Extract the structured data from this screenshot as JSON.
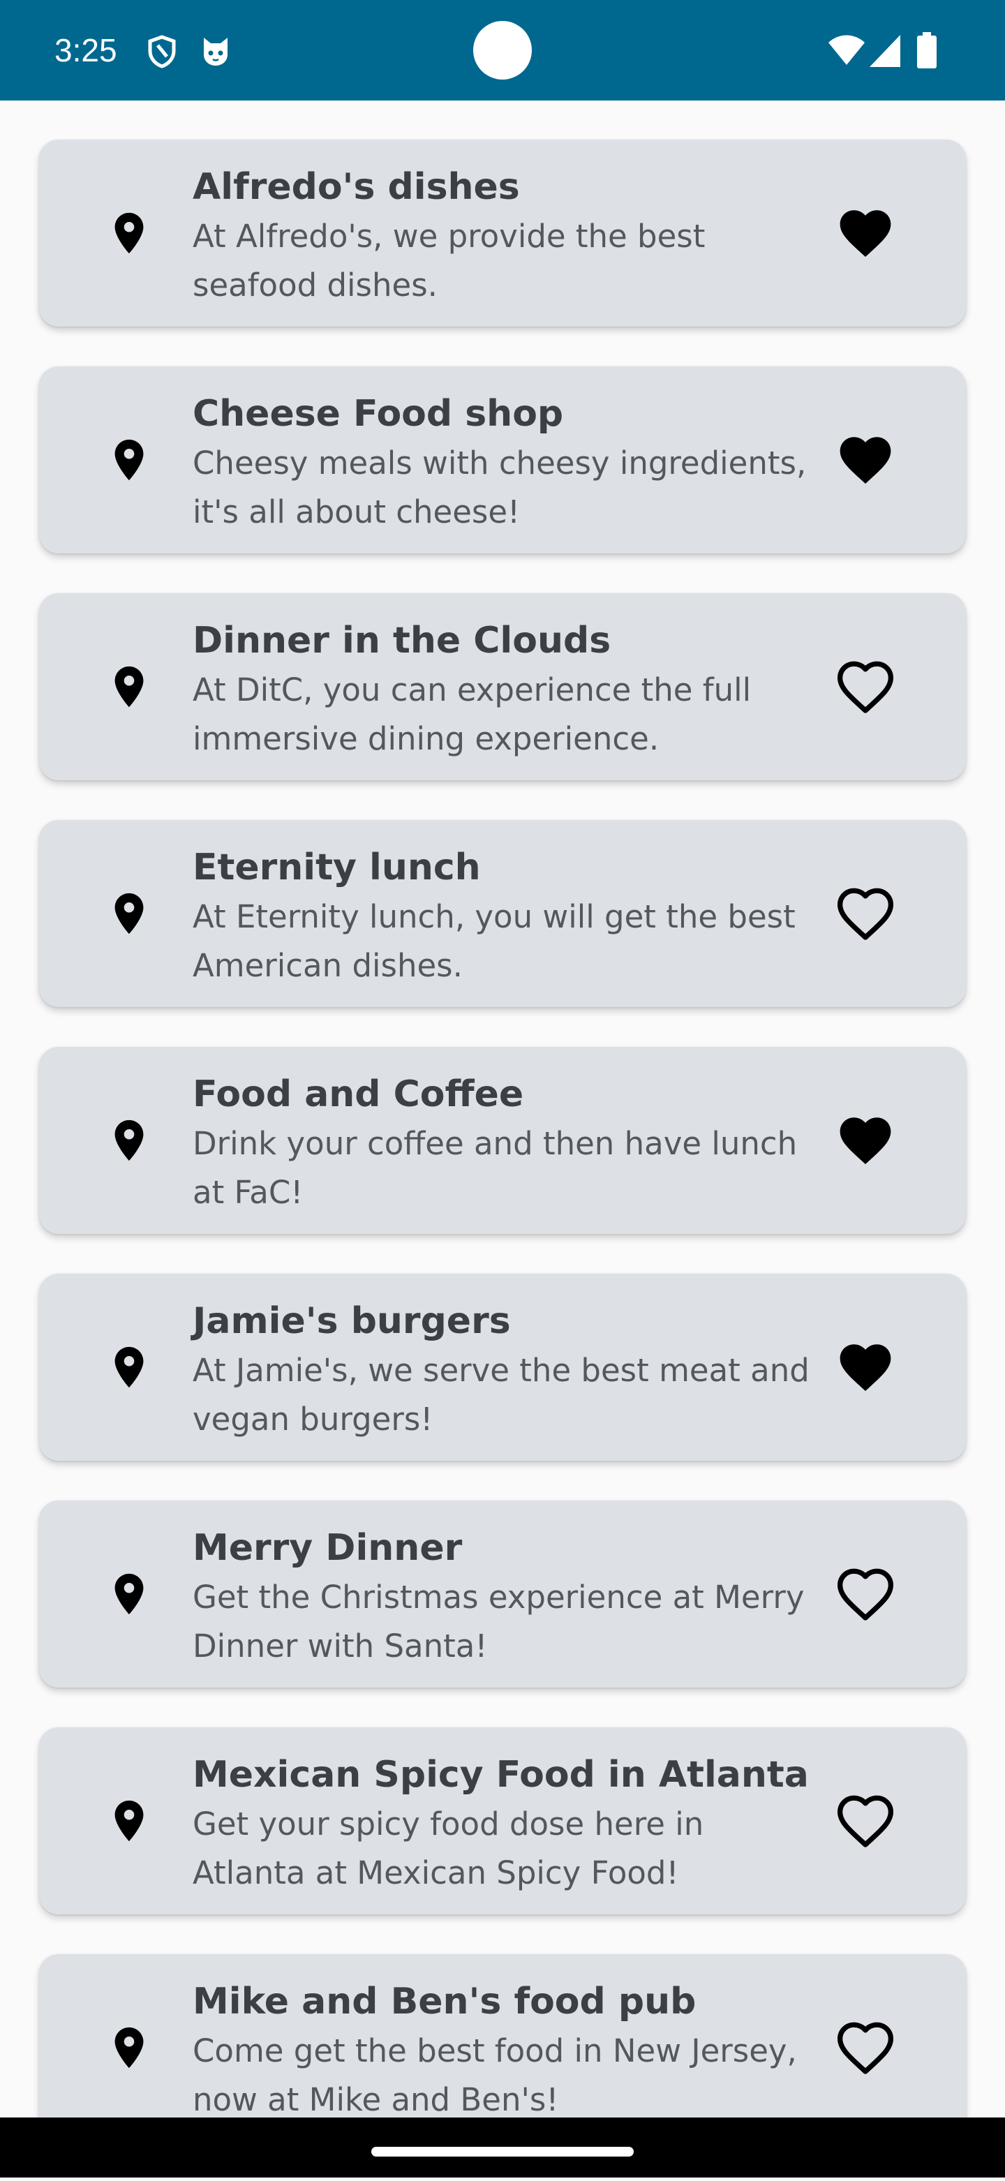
{
  "status_bar": {
    "time": "3:25",
    "background": "#00688f",
    "left_icons": [
      "shield-icon",
      "cat-face-icon"
    ],
    "right_icons": [
      "wifi-icon",
      "cellular-signal-icon",
      "battery-icon"
    ]
  },
  "restaurants": [
    {
      "name": "Alfredo's dishes",
      "description": "At Alfredo's, we provide the best seafood dishes.",
      "favorite": true
    },
    {
      "name": "Cheese Food shop",
      "description": "Cheesy meals with cheesy ingredients, it's all about cheese!",
      "favorite": true
    },
    {
      "name": "Dinner in the Clouds",
      "description": "At DitC, you can experience the full immersive dining experience.",
      "favorite": false
    },
    {
      "name": "Eternity lunch",
      "description": "At Eternity lunch, you will get the best American dishes.",
      "favorite": false
    },
    {
      "name": "Food and Coffee",
      "description": "Drink your coffee and then have lunch at FaC!",
      "favorite": true
    },
    {
      "name": "Jamie's burgers",
      "description": "At Jamie's, we serve the best meat and vegan burgers!",
      "favorite": true
    },
    {
      "name": "Merry Dinner",
      "description": "Get the Christmas experience at Merry Dinner with Santa!",
      "favorite": false
    },
    {
      "name": "Mexican Spicy Food in Atlanta",
      "description": "Get your spicy food dose here in Atlanta at Mexican Spicy Food!",
      "favorite": false
    },
    {
      "name": "Mike and Ben's food pub",
      "description": "Come get the best food in New Jersey, now at Mike and Ben's!",
      "favorite": false
    }
  ],
  "colors": {
    "card_background": "#dde1e6",
    "title_text": "#3c4045",
    "description_text": "#53585e",
    "icon": "#000000",
    "page_background": "#fafafa"
  }
}
